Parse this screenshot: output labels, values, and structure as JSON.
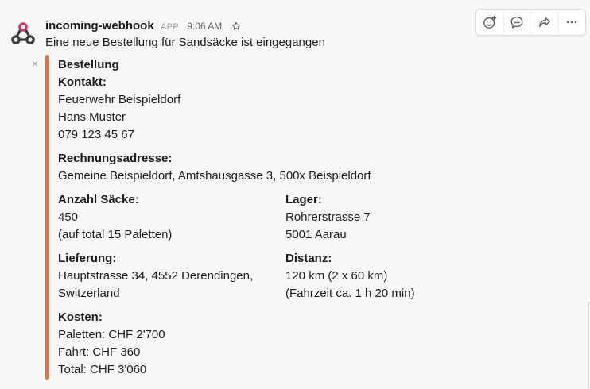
{
  "message": {
    "sender": "incoming-webhook",
    "app_badge": "APP",
    "timestamp": "9:06 AM",
    "text": "Eine neue Bestellung für Sandsäcke ist eingegangen"
  },
  "toolbar": {
    "actions": [
      "add-reaction-icon",
      "reply-thread-icon",
      "share-icon",
      "more-actions-icon"
    ],
    "more_label": "···"
  },
  "attachment": {
    "dismiss": "×",
    "accent_color": "#e8703a",
    "title": "Bestellung",
    "kontakt": {
      "label": "Kontakt:",
      "lines": [
        "Feuerwehr Beispieldorf",
        "Hans Muster",
        "079 123 45 67"
      ]
    },
    "rechnung": {
      "label": "Rechnungsadresse:",
      "value": "Gemeine Beispieldorf, Amtshausgasse 3, 500x Beispieldorf"
    },
    "anzahl": {
      "label": "Anzahl Säcke:",
      "lines": [
        "450",
        "(auf total 15 Paletten)"
      ]
    },
    "lager": {
      "label": "Lager:",
      "lines": [
        "Rohrerstrasse 7",
        "5001 Aarau"
      ]
    },
    "lieferung": {
      "label": "Lieferung:",
      "lines": [
        "Hauptstrasse 34, 4552 Derendingen,",
        "Switzerland"
      ]
    },
    "distanz": {
      "label": "Distanz:",
      "lines": [
        "120 km (2 x 60 km)",
        "(Fahrzeit ca. 1 h 20 min)"
      ]
    },
    "kosten": {
      "label": "Kosten:",
      "lines": [
        "Paletten: CHF 2'700",
        "Fahrt: CHF 360",
        "Total: CHF 3'060"
      ]
    }
  }
}
